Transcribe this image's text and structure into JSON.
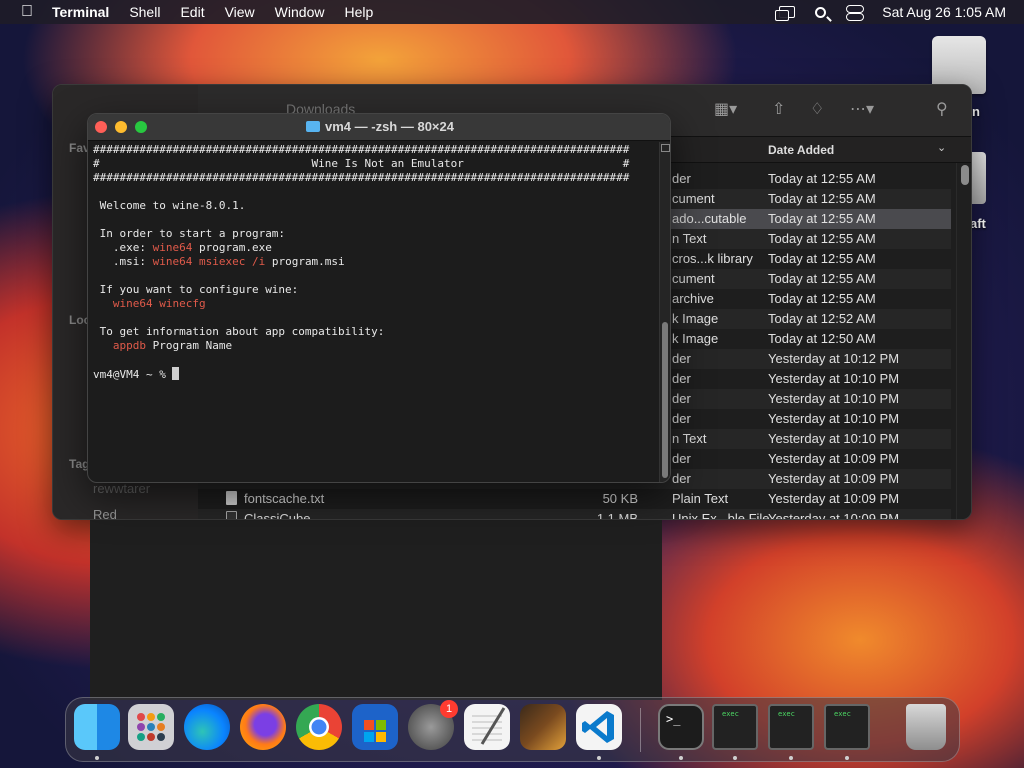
{
  "menubar": {
    "app_name": "Terminal",
    "menus": [
      "Shell",
      "Edit",
      "View",
      "Window",
      "Help"
    ],
    "datetime": "Sat Aug 26  1:05 AM"
  },
  "desktop": {
    "labels": [
      "n",
      "aft"
    ]
  },
  "finder": {
    "title": "Downloads",
    "sidebar": {
      "favorites": "Fav",
      "locations": "Loc",
      "tags": "Tag",
      "items": [
        "rewwtarer",
        "Red"
      ]
    },
    "date_header": "Date Added",
    "rows": [
      {
        "kind": "der",
        "date": "Today at 12:55 AM"
      },
      {
        "kind": "cument",
        "date": "Today at 12:55 AM"
      },
      {
        "kind": "ado...cutable",
        "date": "Today at 12:55 AM",
        "selected": true
      },
      {
        "kind": "n Text",
        "date": "Today at 12:55 AM"
      },
      {
        "kind": "cros...k library",
        "date": "Today at 12:55 AM"
      },
      {
        "kind": "cument",
        "date": "Today at 12:55 AM"
      },
      {
        "kind": "archive",
        "date": "Today at 12:55 AM"
      },
      {
        "kind": "k Image",
        "date": "Today at 12:52 AM"
      },
      {
        "kind": "k Image",
        "date": "Today at 12:50 AM"
      },
      {
        "kind": "der",
        "date": "Yesterday at 10:12 PM"
      },
      {
        "kind": "der",
        "date": "Yesterday at 10:10 PM"
      },
      {
        "kind": "der",
        "date": "Yesterday at 10:10 PM"
      },
      {
        "kind": "der",
        "date": "Yesterday at 10:10 PM"
      },
      {
        "kind": "n Text",
        "date": "Yesterday at 10:10 PM"
      },
      {
        "kind": "der",
        "date": "Yesterday at 10:09 PM"
      },
      {
        "kind": "der",
        "date": "Yesterday at 10:09 PM"
      }
    ],
    "file_row": {
      "name": "fontscache.txt",
      "size": "50 KB",
      "kind": "Plain Text",
      "date": "Yesterday at 10:09 PM"
    },
    "partial_row": {
      "name": "ClassiCube",
      "size": "1.1 MB",
      "kind": "Unix Ex...ble File",
      "date": "Yesterday at 10:09 PM"
    }
  },
  "terminal": {
    "title": "vm4 — -zsh — 80×24",
    "banner_border": "#################################################################################",
    "banner_title": "#                                Wine Is Not an Emulator                        #",
    "welcome": "Welcome to wine-8.0.1.",
    "start_heading": "In order to start a program:",
    "exe_label": "  .exe: ",
    "exe_cmd": "wine64",
    "exe_arg": " program.exe",
    "msi_label": "  .msi: ",
    "msi_cmd": "wine64 msiexec /i",
    "msi_arg": " program.msi",
    "config_heading": "If you want to configure wine:",
    "config_cmd": "  wine64 winecfg",
    "compat_heading": "To get information about app compatibility:",
    "compat_cmd": "  appdb",
    "compat_arg": " Program Name",
    "prompt": "vm4@VM4 ~ % "
  },
  "dock": {
    "apps": [
      "finder-icon",
      "launchpad-icon",
      "edge-icon",
      "firefox-icon",
      "chrome-icon",
      "microsoft-store-icon",
      "system-settings-icon",
      "textedit-icon",
      "garageband-icon",
      "vscode-icon",
      "terminal-icon",
      "exec-window-1",
      "exec-window-2",
      "exec-window-3",
      "trash-icon"
    ],
    "settings_badge": "1",
    "exec_label": "exec",
    "terminal_glyph": ">_"
  }
}
